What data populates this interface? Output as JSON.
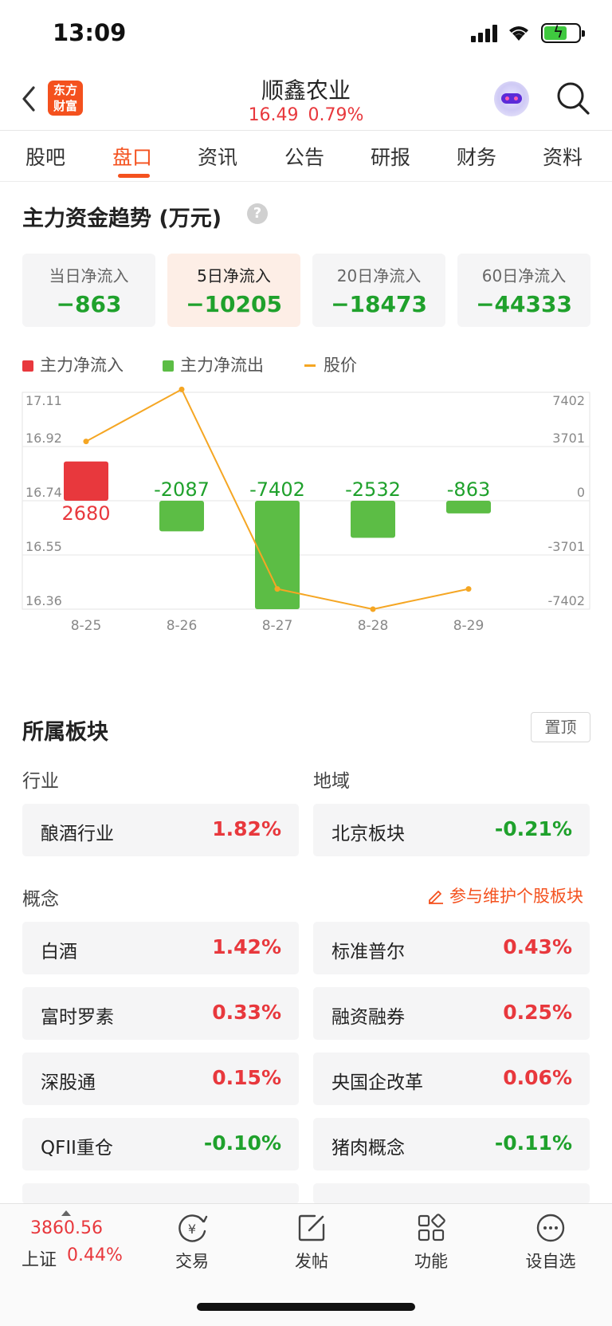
{
  "status_bar": {
    "time": "13:09"
  },
  "header": {
    "logo_line1": "东方",
    "logo_line2": "财富",
    "stock_name": "顺鑫农业",
    "price": "16.49",
    "change_pct": "0.79%"
  },
  "tabs": [
    "股吧",
    "盘口",
    "资讯",
    "公告",
    "研报",
    "财务",
    "资料"
  ],
  "active_tab": "盘口",
  "fund_trend": {
    "title": "主力资金趋势 (万元)",
    "help_icon": "?",
    "cards": [
      {
        "label": "当日净流入",
        "value": "−863"
      },
      {
        "label": "5日净流入",
        "value": "−10205"
      },
      {
        "label": "20日净流入",
        "value": "−18473"
      },
      {
        "label": "60日净流入",
        "value": "−44333"
      }
    ],
    "legend": [
      {
        "label": "主力净流入",
        "color": "#e8383d"
      },
      {
        "label": "主力净流出",
        "color": "#5cbd45"
      },
      {
        "label": "股价",
        "color": "#f5a623"
      }
    ]
  },
  "chart_data": {
    "type": "bar",
    "categories": [
      "8-25",
      "8-26",
      "8-27",
      "8-28",
      "8-29"
    ],
    "series": [
      {
        "name": "主力净流入/流出",
        "values": [
          2680,
          -2087,
          -7402,
          -2532,
          -863
        ]
      },
      {
        "name": "股价",
        "values": [
          16.94,
          17.12,
          16.43,
          16.36,
          16.43
        ]
      }
    ],
    "bar_labels": [
      "2680",
      "-2087",
      "-7402",
      "-2532",
      "-863"
    ],
    "left_axis_ticks": [
      "17.11",
      "16.92",
      "16.74",
      "16.55",
      "16.36"
    ],
    "right_axis_ticks": [
      "7402",
      "3701",
      "0",
      "-3701",
      "-7402"
    ],
    "left_ylim": [
      16.36,
      17.11
    ],
    "right_ylim": [
      -7402,
      7402
    ],
    "colors": {
      "inflow": "#e8383d",
      "outflow": "#5cbd45",
      "price": "#f5a623"
    }
  },
  "sectors": {
    "title": "所属板块",
    "pin_label": "置顶",
    "industry_label": "行业",
    "region_label": "地域",
    "industry": {
      "name": "酿酒行业",
      "pct": "1.82%"
    },
    "region": {
      "name": "北京板块",
      "pct": "-0.21%"
    },
    "concept_label": "概念",
    "edit_link": "参与维护个股板块",
    "concepts": [
      {
        "name": "白酒",
        "pct": "1.42%"
      },
      {
        "name": "标准普尔",
        "pct": "0.43%"
      },
      {
        "name": "富时罗素",
        "pct": "0.33%"
      },
      {
        "name": "融资融券",
        "pct": "0.25%"
      },
      {
        "name": "深股通",
        "pct": "0.15%"
      },
      {
        "name": "央国企改革",
        "pct": "0.06%"
      },
      {
        "name": "QFII重仓",
        "pct": "-0.10%"
      },
      {
        "name": "猪肉概念",
        "pct": "-0.11%"
      }
    ]
  },
  "bottom_bar": {
    "index_value": "3860.56",
    "index_name": "上证",
    "index_pct": "0.44%",
    "nav": [
      "交易",
      "发帖",
      "功能",
      "设自选"
    ]
  }
}
